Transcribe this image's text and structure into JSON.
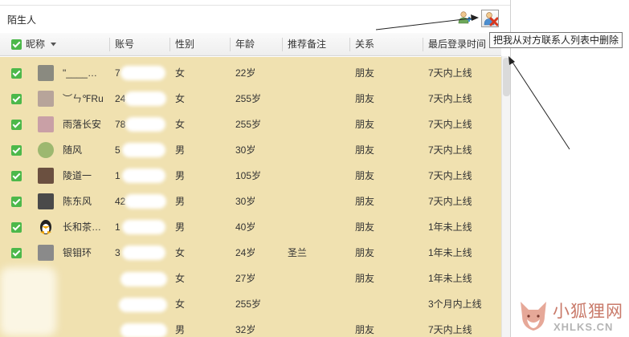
{
  "window": {
    "title": "陌生人"
  },
  "toolbar": {
    "tooltip": "把我从对方联系人列表中删除"
  },
  "header": {
    "columns": [
      "昵称",
      "账号",
      "性别",
      "年龄",
      "推荐备注",
      "关系",
      "最后登录时间"
    ]
  },
  "rows": [
    {
      "nick": "\"____…",
      "acct": "7",
      "sex": "女",
      "age": "22岁",
      "remark": "",
      "rel": "朋友",
      "login": "7天内上线",
      "avatar_color": "#8a8a80"
    },
    {
      "nick": "︶ㄣ℉Ru",
      "acct": "24",
      "sex": "女",
      "age": "255岁",
      "remark": "",
      "rel": "朋友",
      "login": "7天内上线",
      "avatar_color": "#b7a49a"
    },
    {
      "nick": "雨落长安",
      "acct": "78",
      "sex": "女",
      "age": "255岁",
      "remark": "",
      "rel": "朋友",
      "login": "7天内上线",
      "avatar_color": "#c9a0a6"
    },
    {
      "nick": "随风",
      "acct": "5",
      "sex": "男",
      "age": "30岁",
      "remark": "",
      "rel": "朋友",
      "login": "7天内上线",
      "avatar_color": "#9db870"
    },
    {
      "nick": "陵道一",
      "acct": "1",
      "sex": "男",
      "age": "105岁",
      "remark": "",
      "rel": "朋友",
      "login": "7天内上线",
      "avatar_color": "#6b5040"
    },
    {
      "nick": "陈东风",
      "acct": "42",
      "sex": "男",
      "age": "30岁",
      "remark": "",
      "rel": "朋友",
      "login": "7天内上线",
      "avatar_color": "#4a4a4a"
    },
    {
      "nick": "长和茶…",
      "acct": "1",
      "sex": "男",
      "age": "40岁",
      "remark": "",
      "rel": "朋友",
      "login": "1年未上线",
      "avatar_color": "#e0a020"
    },
    {
      "nick": "银钼环",
      "acct": "3",
      "sex": "女",
      "age": "24岁",
      "remark": "圣兰",
      "rel": "朋友",
      "login": "1年未上线",
      "avatar_color": "#8a8a8a"
    },
    {
      "nick": "",
      "acct": "",
      "sex": "女",
      "age": "27岁",
      "remark": "",
      "rel": "朋友",
      "login": "1年未上线",
      "avatar_color": "#f0e1b0"
    },
    {
      "nick": "",
      "acct": "",
      "sex": "女",
      "age": "255岁",
      "remark": "",
      "rel": "",
      "login": "3个月内上线",
      "avatar_color": "#f0e1b0"
    },
    {
      "nick": "",
      "acct": "",
      "sex": "男",
      "age": "32岁",
      "remark": "",
      "rel": "朋友",
      "login": "7天内上线",
      "avatar_color": "#f0e1b0"
    }
  ],
  "watermark": {
    "cn": "小狐狸网",
    "en": "XHLKS.CN"
  },
  "colors": {
    "row_bg": "#f0e1b0",
    "check_green": "#4cb84a",
    "delete_red": "#d9381e"
  }
}
